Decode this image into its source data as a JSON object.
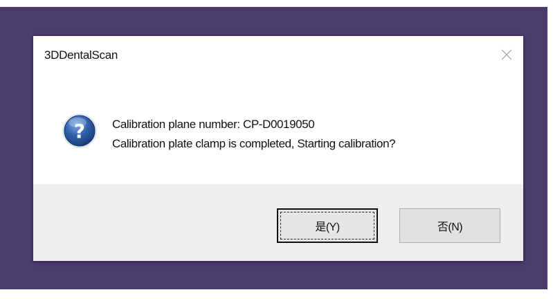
{
  "dialog": {
    "title": "3DDentalScan",
    "message_line1": "Calibration plane number: CP-D0019050",
    "message_line2": "Calibration plate clamp is completed, Starting calibration?",
    "icon": "question-icon",
    "close_icon": "close-icon"
  },
  "buttons": {
    "yes_label": "是(Y)",
    "no_label": "否(N)"
  },
  "colors": {
    "backdrop": "#4b3c6e",
    "footer": "#eeeeee",
    "icon_blue": "#2f5ea8"
  }
}
